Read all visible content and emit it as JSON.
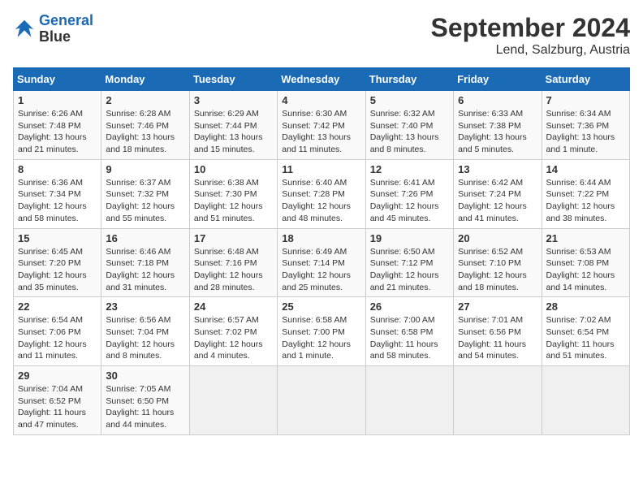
{
  "logo": {
    "line1": "General",
    "line2": "Blue"
  },
  "title": "September 2024",
  "subtitle": "Lend, Salzburg, Austria",
  "weekdays": [
    "Sunday",
    "Monday",
    "Tuesday",
    "Wednesday",
    "Thursday",
    "Friday",
    "Saturday"
  ],
  "weeks": [
    [
      {
        "day": "1",
        "info": "Sunrise: 6:26 AM\nSunset: 7:48 PM\nDaylight: 13 hours\nand 21 minutes."
      },
      {
        "day": "2",
        "info": "Sunrise: 6:28 AM\nSunset: 7:46 PM\nDaylight: 13 hours\nand 18 minutes."
      },
      {
        "day": "3",
        "info": "Sunrise: 6:29 AM\nSunset: 7:44 PM\nDaylight: 13 hours\nand 15 minutes."
      },
      {
        "day": "4",
        "info": "Sunrise: 6:30 AM\nSunset: 7:42 PM\nDaylight: 13 hours\nand 11 minutes."
      },
      {
        "day": "5",
        "info": "Sunrise: 6:32 AM\nSunset: 7:40 PM\nDaylight: 13 hours\nand 8 minutes."
      },
      {
        "day": "6",
        "info": "Sunrise: 6:33 AM\nSunset: 7:38 PM\nDaylight: 13 hours\nand 5 minutes."
      },
      {
        "day": "7",
        "info": "Sunrise: 6:34 AM\nSunset: 7:36 PM\nDaylight: 13 hours\nand 1 minute."
      }
    ],
    [
      {
        "day": "8",
        "info": "Sunrise: 6:36 AM\nSunset: 7:34 PM\nDaylight: 12 hours\nand 58 minutes."
      },
      {
        "day": "9",
        "info": "Sunrise: 6:37 AM\nSunset: 7:32 PM\nDaylight: 12 hours\nand 55 minutes."
      },
      {
        "day": "10",
        "info": "Sunrise: 6:38 AM\nSunset: 7:30 PM\nDaylight: 12 hours\nand 51 minutes."
      },
      {
        "day": "11",
        "info": "Sunrise: 6:40 AM\nSunset: 7:28 PM\nDaylight: 12 hours\nand 48 minutes."
      },
      {
        "day": "12",
        "info": "Sunrise: 6:41 AM\nSunset: 7:26 PM\nDaylight: 12 hours\nand 45 minutes."
      },
      {
        "day": "13",
        "info": "Sunrise: 6:42 AM\nSunset: 7:24 PM\nDaylight: 12 hours\nand 41 minutes."
      },
      {
        "day": "14",
        "info": "Sunrise: 6:44 AM\nSunset: 7:22 PM\nDaylight: 12 hours\nand 38 minutes."
      }
    ],
    [
      {
        "day": "15",
        "info": "Sunrise: 6:45 AM\nSunset: 7:20 PM\nDaylight: 12 hours\nand 35 minutes."
      },
      {
        "day": "16",
        "info": "Sunrise: 6:46 AM\nSunset: 7:18 PM\nDaylight: 12 hours\nand 31 minutes."
      },
      {
        "day": "17",
        "info": "Sunrise: 6:48 AM\nSunset: 7:16 PM\nDaylight: 12 hours\nand 28 minutes."
      },
      {
        "day": "18",
        "info": "Sunrise: 6:49 AM\nSunset: 7:14 PM\nDaylight: 12 hours\nand 25 minutes."
      },
      {
        "day": "19",
        "info": "Sunrise: 6:50 AM\nSunset: 7:12 PM\nDaylight: 12 hours\nand 21 minutes."
      },
      {
        "day": "20",
        "info": "Sunrise: 6:52 AM\nSunset: 7:10 PM\nDaylight: 12 hours\nand 18 minutes."
      },
      {
        "day": "21",
        "info": "Sunrise: 6:53 AM\nSunset: 7:08 PM\nDaylight: 12 hours\nand 14 minutes."
      }
    ],
    [
      {
        "day": "22",
        "info": "Sunrise: 6:54 AM\nSunset: 7:06 PM\nDaylight: 12 hours\nand 11 minutes."
      },
      {
        "day": "23",
        "info": "Sunrise: 6:56 AM\nSunset: 7:04 PM\nDaylight: 12 hours\nand 8 minutes."
      },
      {
        "day": "24",
        "info": "Sunrise: 6:57 AM\nSunset: 7:02 PM\nDaylight: 12 hours\nand 4 minutes."
      },
      {
        "day": "25",
        "info": "Sunrise: 6:58 AM\nSunset: 7:00 PM\nDaylight: 12 hours\nand 1 minute."
      },
      {
        "day": "26",
        "info": "Sunrise: 7:00 AM\nSunset: 6:58 PM\nDaylight: 11 hours\nand 58 minutes."
      },
      {
        "day": "27",
        "info": "Sunrise: 7:01 AM\nSunset: 6:56 PM\nDaylight: 11 hours\nand 54 minutes."
      },
      {
        "day": "28",
        "info": "Sunrise: 7:02 AM\nSunset: 6:54 PM\nDaylight: 11 hours\nand 51 minutes."
      }
    ],
    [
      {
        "day": "29",
        "info": "Sunrise: 7:04 AM\nSunset: 6:52 PM\nDaylight: 11 hours\nand 47 minutes."
      },
      {
        "day": "30",
        "info": "Sunrise: 7:05 AM\nSunset: 6:50 PM\nDaylight: 11 hours\nand 44 minutes."
      },
      {
        "day": "",
        "info": ""
      },
      {
        "day": "",
        "info": ""
      },
      {
        "day": "",
        "info": ""
      },
      {
        "day": "",
        "info": ""
      },
      {
        "day": "",
        "info": ""
      }
    ]
  ]
}
